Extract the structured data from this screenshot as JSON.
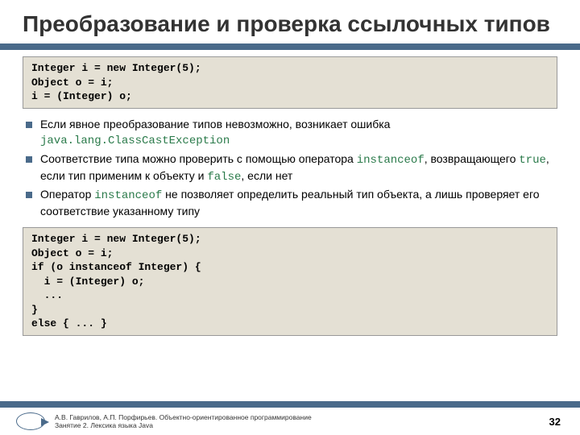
{
  "title": "Преобразование и проверка ссылочных типов",
  "code1": "Integer i = new Integer(5);\nObject o = i;\ni = (Integer) o;",
  "bullets": [
    {
      "pre": "Если явное преобразование типов невозможно, возникает ошибка ",
      "kw": "java.lang.ClassCastException",
      "post": ""
    },
    {
      "pre": "Соответствие типа можно проверить с помощью оператора ",
      "kw": "instanceof",
      "mid": ", возвращающего ",
      "kw2": "true",
      "mid2": ", если тип применим к объекту и ",
      "kw3": "false",
      "post": ", если нет"
    },
    {
      "pre": "Оператор ",
      "kw": "instanceof",
      "post": " не позволяет определить реальный тип объекта, а лишь проверяет его соответствие указанному типу"
    }
  ],
  "code2": "Integer i = new Integer(5);\nObject o = i;\nif (o instanceof Integer) {\n  i = (Integer) o;\n  ...\n}\nelse { ... }",
  "footer": {
    "line1": "А.В. Гаврилов, А.П. Порфирьев. Объектно-ориентированное программирование",
    "line2": "Занятие 2. Лексика языка Java"
  },
  "page": "32"
}
